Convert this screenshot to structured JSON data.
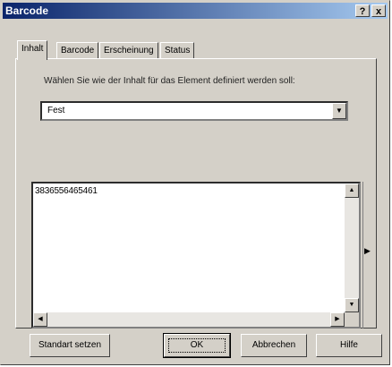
{
  "window": {
    "title": "Barcode"
  },
  "titlebar_buttons": {
    "help": "?",
    "close": "x"
  },
  "tabs": [
    {
      "label": "Inhalt",
      "active": true
    },
    {
      "label": "Barcode",
      "active": false
    },
    {
      "label": "Erscheinung",
      "active": false
    },
    {
      "label": "Status",
      "active": false
    }
  ],
  "inhalt": {
    "instruction": "Wählen Sie wie der Inhalt für das Element definiert werden soll:",
    "mode_select": {
      "value": "Fest"
    },
    "text_value": "3836556465461"
  },
  "buttons": {
    "default": "Standart setzen",
    "ok": "OK",
    "cancel": "Abbrechen",
    "help": "Hilfe"
  },
  "icons": {
    "dropdown": "triangle-down",
    "scroll_up": "triangle-up",
    "scroll_down": "triangle-down",
    "scroll_left": "triangle-left",
    "scroll_right": "triangle-right",
    "side_arrow": "triangle-right"
  }
}
